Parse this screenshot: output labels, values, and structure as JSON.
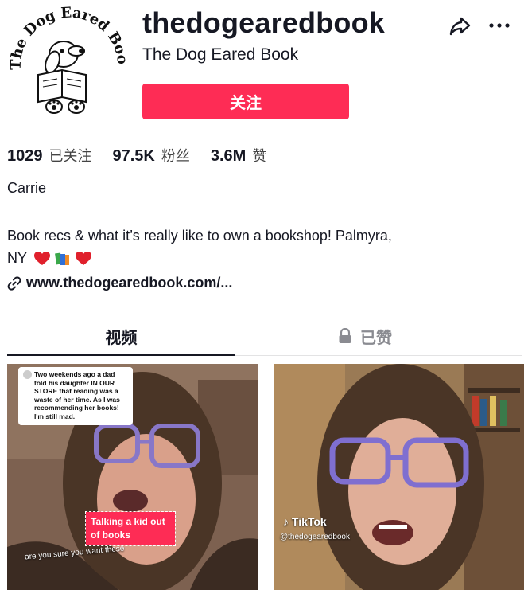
{
  "profile": {
    "username": "thedogearedbook",
    "nickname": "The Dog Eared Book",
    "follow_label": "关注",
    "logo_text": "The Dog Eared Book"
  },
  "stats": {
    "following_count": "1029",
    "following_label": "已关注",
    "followers_count": "97.5K",
    "followers_label": "粉丝",
    "likes_count": "3.6M",
    "likes_label": "赞"
  },
  "bio": {
    "name": "Carrie",
    "line1": "Book recs & what it’s really like to own a bookshop! Palmyra,",
    "line2": "NY",
    "link": "www.thedogearedbook.com/..."
  },
  "tabs": {
    "videos": "视频",
    "liked": "已赞"
  },
  "videos": [
    {
      "comment": "Two weekends ago a dad told his daughter IN OUR STORE that reading was a waste of her time. As I was recommending her books! I'm still mad.",
      "sticker": "Talking a kid out of books",
      "caption": "are you sure you want these"
    },
    {
      "watermark": "TikTok",
      "handle": "@thedogearedbook"
    }
  ],
  "colors": {
    "accent": "#fe2c55",
    "text": "#161823",
    "muted": "#8a8b91"
  }
}
